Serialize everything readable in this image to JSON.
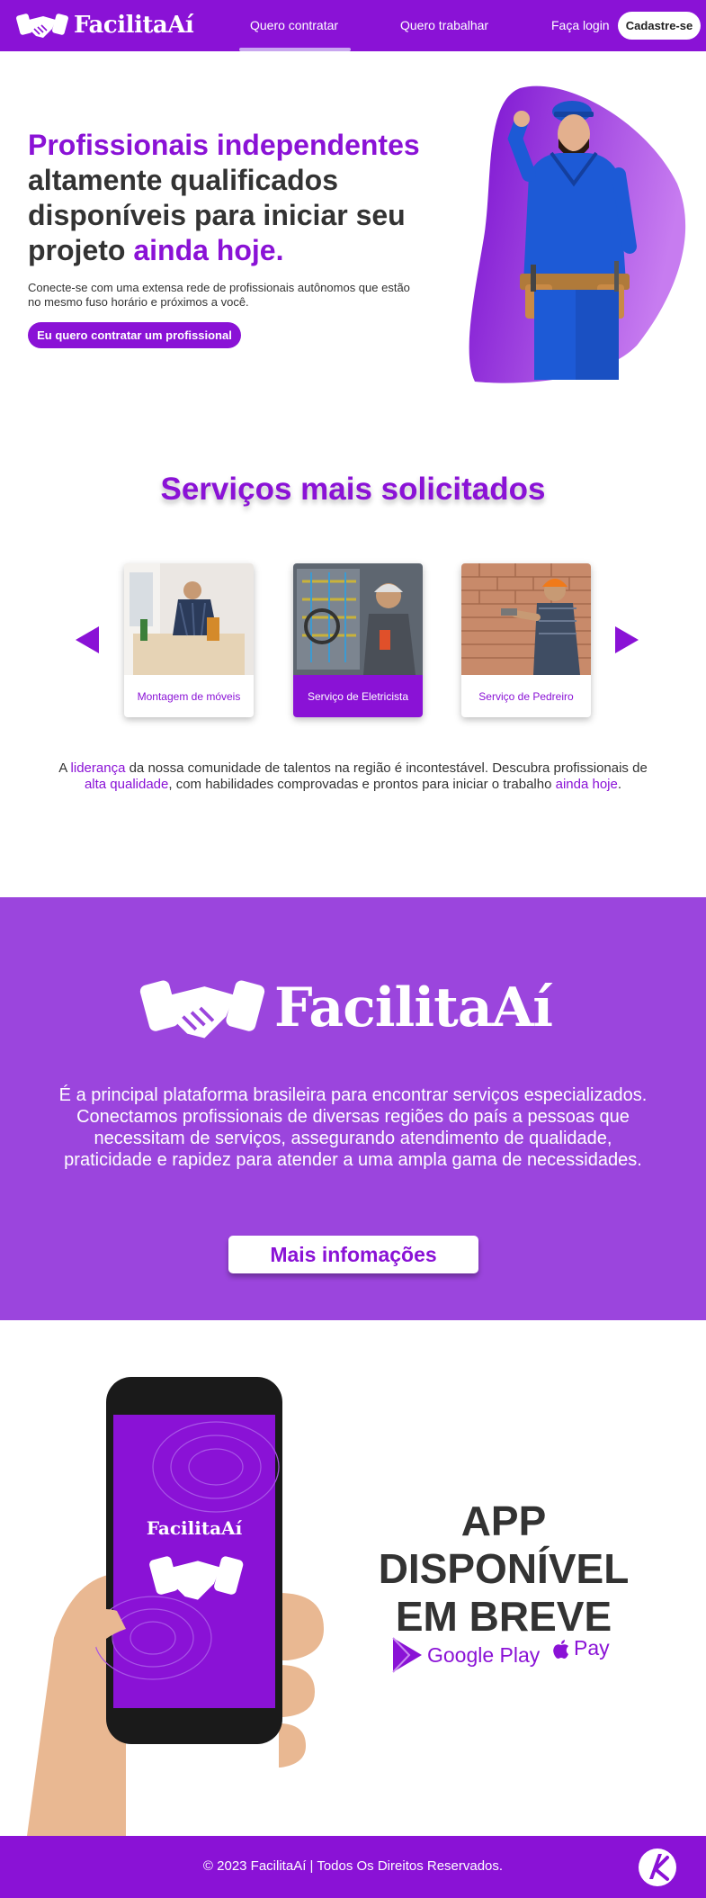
{
  "brand": {
    "name": "FacilitaAí",
    "primary": "#8a12d6",
    "secondary": "#9b45dd"
  },
  "nav": {
    "hire": "Quero contratar",
    "work": "Quero trabalhar",
    "login": "Faça login",
    "signup": "Cadastre-se"
  },
  "hero": {
    "title_a": "Profissionais independentes",
    "title_b": " altamente qualificados disponíveis para iniciar seu projeto ",
    "title_c": "ainda hoje.",
    "subtitle": "Conecte-se com uma extensa rede de profissionais autônomos que estão no mesmo fuso horário e próximos a você.",
    "cta": "Eu quero contratar um profissional"
  },
  "services": {
    "title": "Serviços mais solicitados",
    "cards": [
      {
        "label": "Montagem de móveis",
        "active": false
      },
      {
        "label": "Serviço de Eletricista",
        "active": true
      },
      {
        "label": "Serviço de Pedreiro",
        "active": false
      }
    ],
    "desc": {
      "p1": "A ",
      "h1": "liderança",
      "p2": " da nossa comunidade de talentos na região é incontestável. Descubra profissionais de ",
      "h2": "alta qualidade",
      "p3": ", com habilidades comprovadas e prontos para iniciar o trabalho ",
      "h3": "ainda hoje",
      "p4": "."
    }
  },
  "about": {
    "text": "É a principal plataforma brasileira para encontrar serviços especializados. Conectamos profissionais de diversas regiões do país a pessoas que necessitam de serviços, assegurando atendimento de qualidade, praticidade e rapidez para atender a uma ampla gama de necessidades.",
    "cta": "Mais infomações"
  },
  "app": {
    "title": "APP DISPONÍVEL EM BREVE",
    "google": "Google Play",
    "apple": "Pay",
    "phone_brand": "FacilitaAí"
  },
  "footer": {
    "text": "© 2023 FacilitaAí | Todos Os Direitos Reservados."
  }
}
